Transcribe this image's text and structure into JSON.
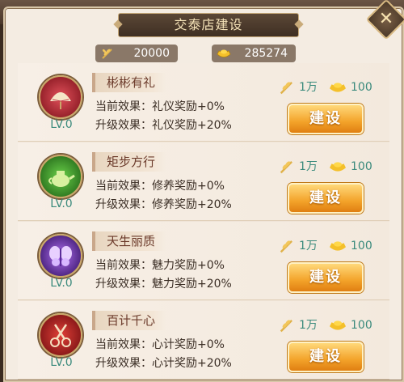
{
  "window": {
    "title": "交泰店建设"
  },
  "currency": {
    "grain": "20000",
    "gold": "285274"
  },
  "items": [
    {
      "name": "彬彬有礼",
      "level": "LV.0",
      "current_label": "当前效果：",
      "current": "礼仪奖励+0%",
      "upgrade_label": "升级效果：",
      "upgrade": "礼仪奖励+20%",
      "cost_grain": "1万",
      "cost_gold": "100",
      "button": "建设",
      "icon": "fan-icon",
      "icon_color": "#b02030"
    },
    {
      "name": "矩步方行",
      "level": "LV.0",
      "current_label": "当前效果：",
      "current": "修养奖励+0%",
      "upgrade_label": "升级效果：",
      "upgrade": "修养奖励+20%",
      "cost_grain": "1万",
      "cost_gold": "100",
      "button": "建设",
      "icon": "teapot-icon",
      "icon_color": "#2f8a2a"
    },
    {
      "name": "天生丽质",
      "level": "LV.0",
      "current_label": "当前效果：",
      "current": "魅力奖励+0%",
      "upgrade_label": "升级效果：",
      "upgrade": "魅力奖励+20%",
      "cost_grain": "1万",
      "cost_gold": "100",
      "button": "建设",
      "icon": "butterfly-icon",
      "icon_color": "#5a2a9a"
    },
    {
      "name": "百计千心",
      "level": "LV.0",
      "current_label": "当前效果：",
      "current": "心计奖励+0%",
      "upgrade_label": "升级效果：",
      "upgrade": "心计奖励+20%",
      "cost_grain": "1万",
      "cost_gold": "100",
      "button": "建设",
      "icon": "scissors-icon",
      "icon_color": "#b01e24"
    }
  ]
}
